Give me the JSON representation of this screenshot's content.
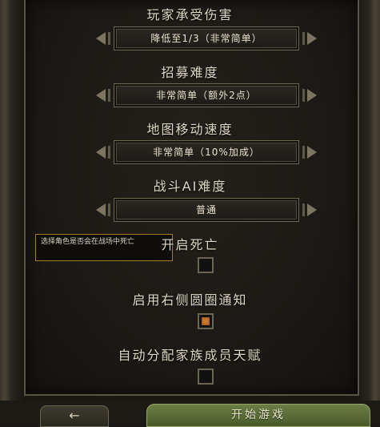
{
  "settings": {
    "damage": {
      "heading": "玩家承受伤害",
      "value": "降低至1/3（非常简单）"
    },
    "recruit": {
      "heading": "招募难度",
      "value": "非常简单（额外2点）"
    },
    "map_speed": {
      "heading": "地图移动速度",
      "value": "非常简单（10%加成）"
    },
    "combat_ai": {
      "heading": "战斗AI难度",
      "value": "普通"
    }
  },
  "toggles": {
    "death": {
      "label": "开启死亡",
      "checked": false
    },
    "notify": {
      "label": "启用右侧圆圈通知",
      "checked": true
    },
    "talent": {
      "label": "自动分配家族成员天赋",
      "checked": false
    }
  },
  "tooltip": {
    "text": "选择角色是否会在战场中死亡"
  },
  "footer": {
    "back_label": "←",
    "start_label": "开始游戏"
  },
  "colors": {
    "accent_orange": "#c9782c",
    "start_green": "#5b6d36",
    "tooltip_border": "#a77b2c"
  }
}
